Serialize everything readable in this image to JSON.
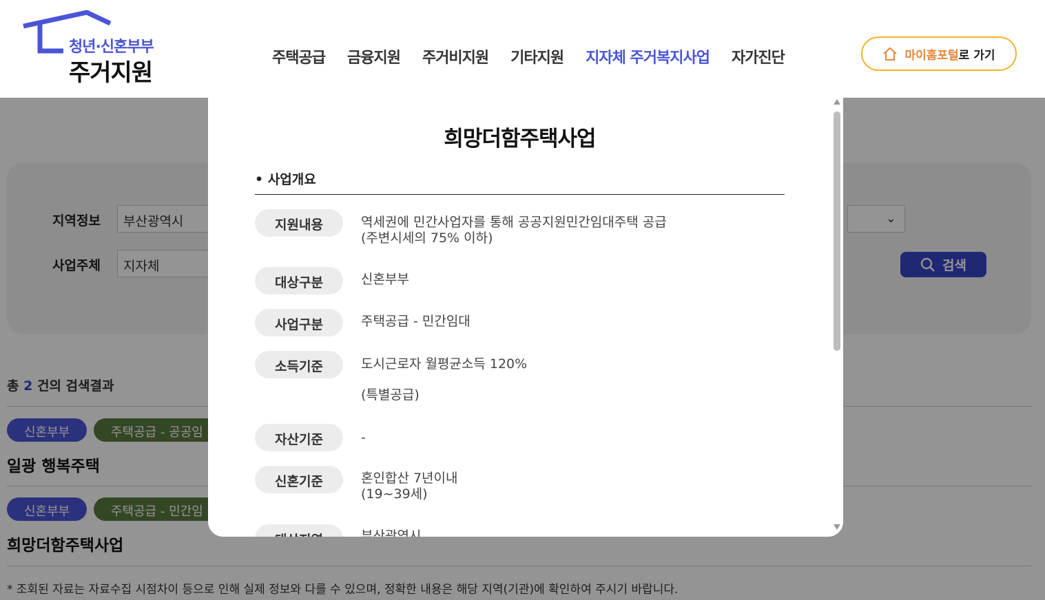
{
  "header": {
    "logo_line1": "청년·신혼부부",
    "logo_line2": "주거지원",
    "nav": [
      "주택공급",
      "금융지원",
      "주거비지원",
      "기타지원",
      "지자체 주거복지사업",
      "자가진단"
    ],
    "active_nav": "지자체 주거복지사업",
    "portal_accent": "마이홈포털",
    "portal_rest": "로 가기",
    "colors": {
      "brand": "#4a55d6",
      "portal_border": "#f0b429",
      "portal_accent": "#e5863a"
    }
  },
  "search": {
    "region_label": "지역정보",
    "region_value": "부산광역시",
    "actor_label": "사업주체",
    "actor_value": "지자체",
    "search_button": "검색"
  },
  "results": {
    "count_prefix": "총",
    "count": "2",
    "count_suffix": "건의 검색결과",
    "items": [
      {
        "tag1": "신혼부부",
        "tag2": "주택공급 - 공공임",
        "title": "일광 행복주택"
      },
      {
        "tag1": "신혼부부",
        "tag2": "주택공급 - 민간임",
        "title": "희망더함주택사업"
      }
    ],
    "note": "* 조회된 자료는 자료수집 시점차이 등으로 인해 실제 정보와 다를 수 있으며, 정확한 내용은 해당 지역(기관)에 확인하여 주시기 바랍니다."
  },
  "modal": {
    "title": "희망더함주택사업",
    "section": "• 사업개요",
    "rows": [
      {
        "label": "지원내용",
        "value": "역세권에 민간사업자를 통해 공공지원민간임대주택 공급",
        "value2": "(주변시세의 75% 이하)"
      },
      {
        "label": "대상구분",
        "value": "신혼부부"
      },
      {
        "label": "사업구분",
        "value": "주택공급 - 민간임대"
      },
      {
        "label": "소득기준",
        "value": "도시근로자 월평균소득 120%",
        "value2": "(특별공급)"
      },
      {
        "label": "자산기준",
        "value": "-"
      },
      {
        "label": "신혼기준",
        "value": "혼인합산 7년이내",
        "value2": "(19~39세)"
      },
      {
        "label": "대상지역",
        "value": "부산광역시"
      }
    ]
  }
}
